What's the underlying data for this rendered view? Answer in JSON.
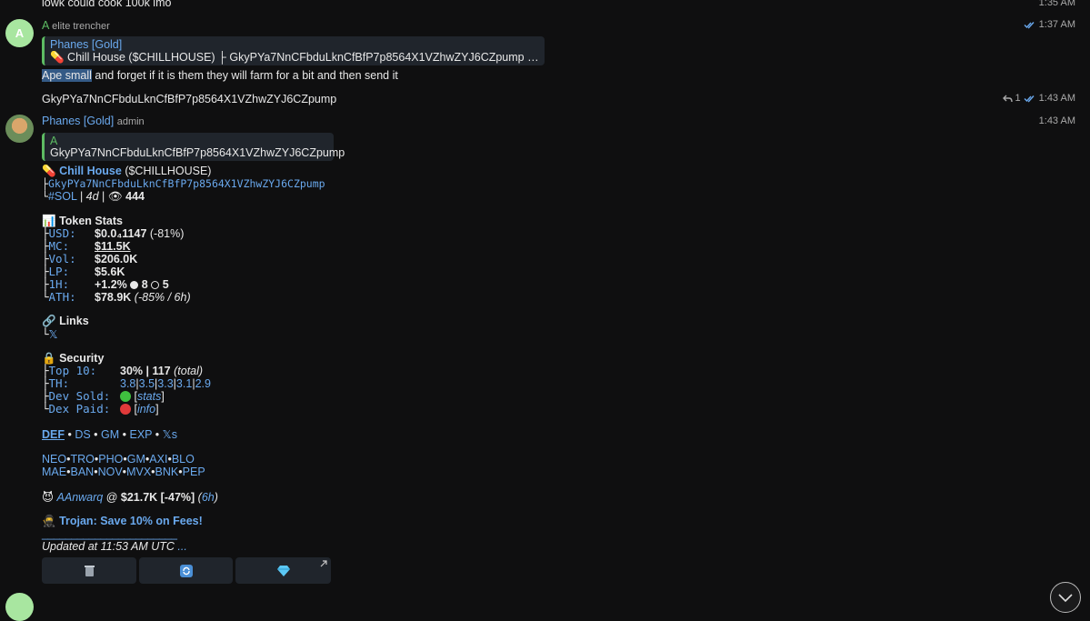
{
  "prev_message": {
    "text": "lowk could cook 100k imo",
    "time": "1:35 AM"
  },
  "msg1": {
    "avatar_letter": "A",
    "sender": "A",
    "role": "elite trencher",
    "quote_title": "Phanes [Gold]",
    "quote_body_prefix": "💊 Chill House ($CHILLHOUSE)  ├ GkyPYa7NnCFbduLknCfBfP7p8564X1VZhwZYJ6CZpump  └ #SOL...",
    "text_highlight": "Ape small",
    "text_rest": " and forget if it is them they will farm for a bit and then send it",
    "time": "1:37 AM"
  },
  "msg2": {
    "text": "GkyPYa7NnCFbduLknCfBfP7p8564X1VZhwZYJ6CZpump",
    "reply_count": "1",
    "time": "1:43 AM"
  },
  "msg3": {
    "sender": "Phanes [Gold]",
    "role": "admin",
    "time": "1:43 AM",
    "quote_author": "A",
    "quote_text": "GkyPYa7NnCFbduLknCfBfP7p8564X1VZhwZYJ6CZpump",
    "token_name": "Chill House",
    "token_ticker": "($CHILLHOUSE)",
    "token_address": "GkyPYa7NnCFbduLknCfBfP7p8564X1VZhwZYJ6CZpump",
    "chain_tag": "#SOL",
    "age": "4d",
    "views": "444",
    "token_stats_title": "Token Stats",
    "stats": [
      {
        "key": "USD:",
        "value": "$0.0₄1147",
        "extra": " (-81%)"
      },
      {
        "key": "MC:",
        "value": "$11.5K",
        "extra": ""
      },
      {
        "key": "Vol:",
        "value": "$206.0K",
        "extra": ""
      },
      {
        "key": "LP:",
        "value": "$5.6K",
        "extra": ""
      },
      {
        "key": "1H:",
        "value": "+1.2%",
        "extra": "8",
        "extra2": "5"
      },
      {
        "key": "ATH:",
        "value": "$78.9K",
        "extra": " (-85% / 6h)"
      }
    ],
    "links_title": "Links",
    "links_x": "𝕏",
    "security_title": "Security",
    "security": [
      {
        "key": "Top 10:",
        "value": "30% | 117",
        "extra": " (total)"
      },
      {
        "key": "TH:",
        "th_values": [
          "3.8",
          "3.5",
          "3.3",
          "3.1",
          "2.9"
        ]
      },
      {
        "key": "Dev Sold:",
        "bracket": "stats"
      },
      {
        "key": "Dex Paid:",
        "bracket": "info"
      }
    ],
    "nav1": [
      "DEF",
      "DS",
      "GM",
      "EXP",
      "𝕏s"
    ],
    "nav2": [
      "NEO",
      "TRO",
      "PHO",
      "GM",
      "AXI",
      "BLO"
    ],
    "nav3": [
      "MAE",
      "BAN",
      "NOV",
      "MVX",
      "BNK",
      "PEP"
    ],
    "caller_name": "AAnwarq",
    "caller_at": " @ ",
    "caller_value": "$21.7K [-47%]",
    "caller_time": "6h",
    "promo": "Trojan: Save 10% on Fees!",
    "divider": "_______________________",
    "updated": "Updated at 11:53 AM UTC",
    "ellipsis": "..."
  },
  "colors": {
    "accent_link": "#6aa9ee",
    "quote_bar": "#5dbb63",
    "avatar_green": "#a8e6a0",
    "bubble": "#20252c"
  }
}
